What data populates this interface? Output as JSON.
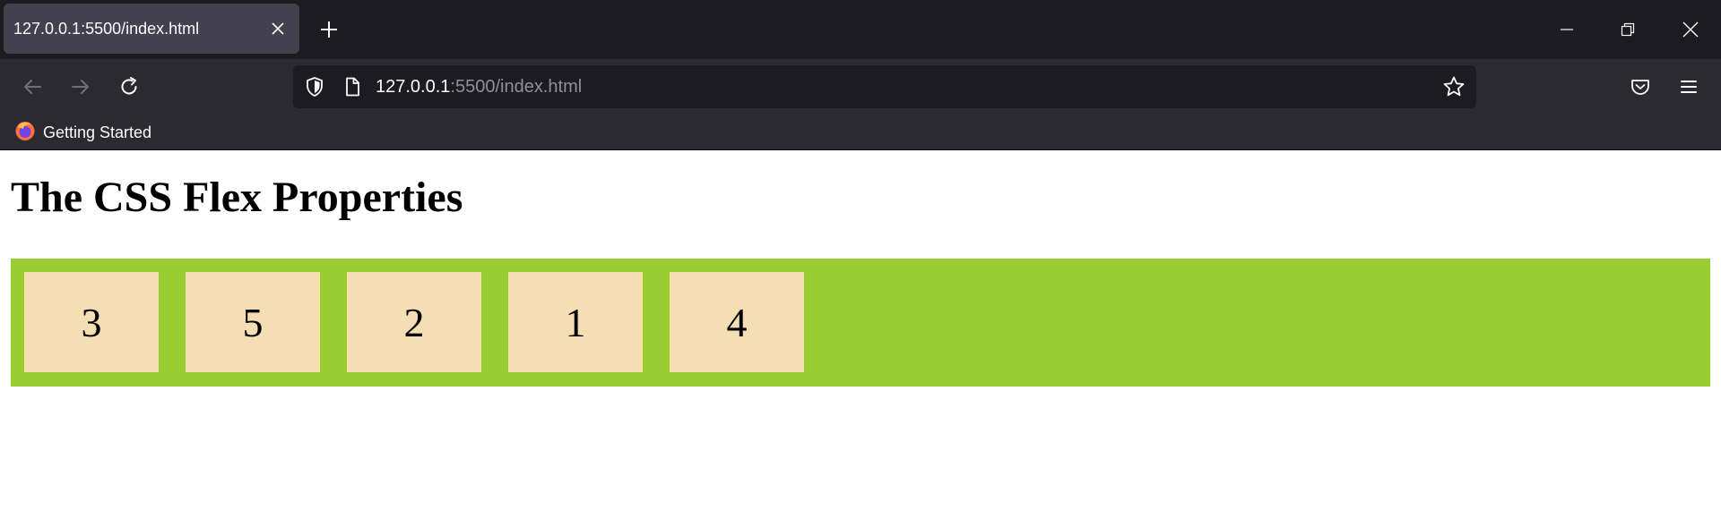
{
  "browser": {
    "tab_title": "127.0.0.1:5500/index.html",
    "url_host": "127.0.0.1",
    "url_path": ":5500/index.html",
    "bookmark_label": "Getting Started",
    "colors": {
      "titlebar": "#1c1b22",
      "toolbar": "#2b2a33",
      "active_tab": "#42414d",
      "url_field": "#1c1b22",
      "text": "#fbfbfe",
      "muted_text": "#8f8f9d"
    },
    "icons": [
      "close-icon",
      "plus-icon",
      "minimize-icon",
      "restore-icon",
      "window-close-icon",
      "back-arrow-icon",
      "forward-arrow-icon",
      "reload-icon",
      "shield-icon",
      "page-icon",
      "star-icon",
      "pocket-icon",
      "hamburger-menu-icon",
      "firefox-icon"
    ]
  },
  "page": {
    "heading": "The CSS Flex Properties",
    "container_color": "#9acd32",
    "item_color": "#f5deb3",
    "items": [
      "3",
      "5",
      "2",
      "1",
      "4"
    ]
  }
}
